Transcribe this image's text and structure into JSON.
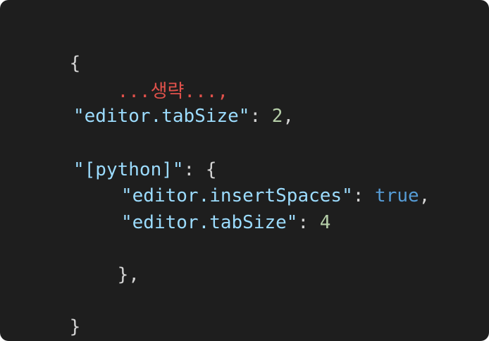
{
  "colors": {
    "background": "#1e1e1e",
    "punctuation": "#d4d4d4",
    "key": "#9cdcfe",
    "number": "#b5cea8",
    "boolean": "#569cd6",
    "omitted": "#e0514b"
  },
  "code": {
    "open_brace": "{",
    "omitted_placeholder": "...생략...,",
    "tabsize_key": "\"editor.tabSize\"",
    "colon": ": ",
    "tabsize_value": "2",
    "comma": ",",
    "python_key": "\"[python]\"",
    "python_open": ": {",
    "insert_spaces_key": "\"editor.insertSpaces\"",
    "insert_spaces_value": "true",
    "python_tabsize_key": "\"editor.tabSize\"",
    "python_tabsize_value": "4",
    "python_close": "},",
    "close_brace": "}"
  }
}
